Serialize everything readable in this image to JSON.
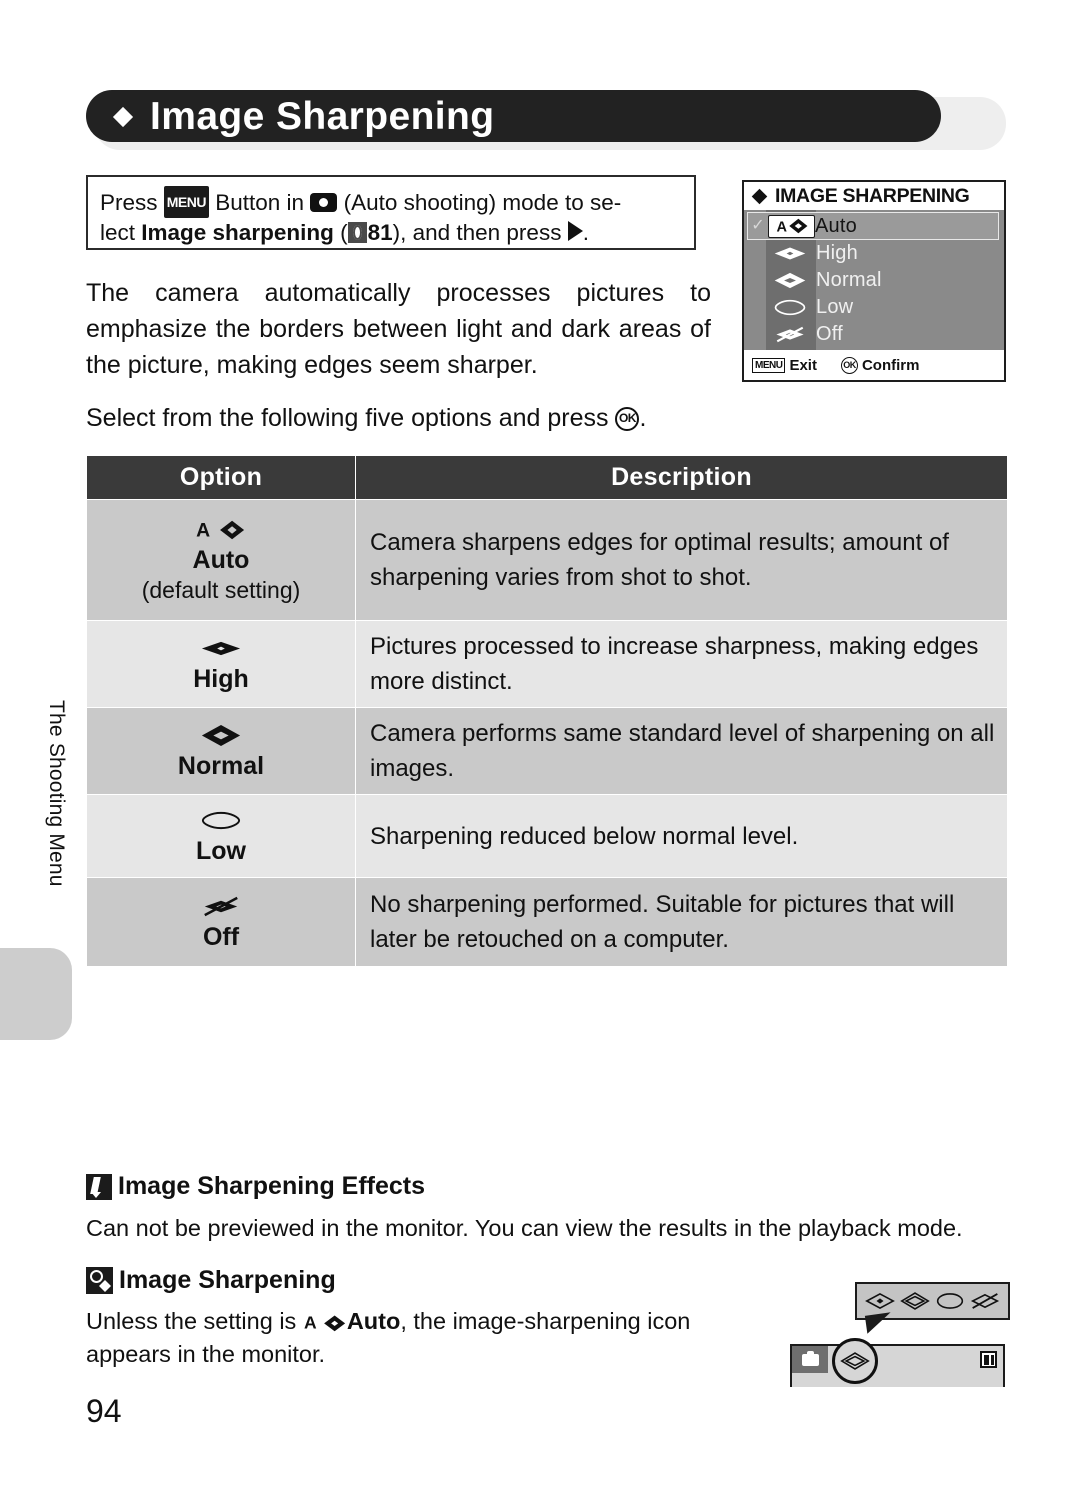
{
  "page": {
    "number": "94",
    "side_tab": "The Shooting Menu",
    "title": "Image Sharpening"
  },
  "instruction": {
    "line1_pre": "Press ",
    "menu_chip": "MENU",
    "line1_mid": " Button in ",
    "camera_icon": "camera-auto-icon",
    "line1_post": " (Auto shooting) mode to se-",
    "line2_pre": "lect ",
    "line2_bold": "Image sharpening",
    "line2_paren_open": " (",
    "ref_icon": "reference-book-icon",
    "ref_page": "81",
    "line2_post": "), and then press ",
    "line2_end": "."
  },
  "body": {
    "paragraph": "The camera automatically processes pictures to emphasize the borders between light and dark areas of the picture, making edges seem sharper.",
    "select_pre": "Select from the following five options and press ",
    "ok_label": "OK",
    "select_post": "."
  },
  "lcd": {
    "title": "IMAGE SHARPENING",
    "rows": [
      {
        "icon": "sharpening-auto-icon",
        "label": "Auto",
        "selected": true,
        "check": "✓"
      },
      {
        "icon": "sharpening-high-icon",
        "label": "High",
        "selected": false,
        "check": ""
      },
      {
        "icon": "sharpening-normal-icon",
        "label": "Normal",
        "selected": false,
        "check": ""
      },
      {
        "icon": "sharpening-low-icon",
        "label": "Low",
        "selected": false,
        "check": ""
      },
      {
        "icon": "sharpening-off-icon",
        "label": "Off",
        "selected": false,
        "check": ""
      }
    ],
    "footer": {
      "menu_chip": "MENU",
      "exit_label": "Exit",
      "ok_chip": "OK",
      "confirm_label": "Confirm"
    }
  },
  "table": {
    "headers": {
      "option": "Option",
      "description": "Description"
    },
    "rows": [
      {
        "icon": "sharpening-auto-icon",
        "name": "Auto",
        "sub": "(default setting)",
        "description": "Camera sharpens edges for optimal results; amount of sharpening varies from shot to shot."
      },
      {
        "icon": "sharpening-high-icon",
        "name": "High",
        "sub": "",
        "description": "Pictures processed to increase sharpness, making edges more distinct."
      },
      {
        "icon": "sharpening-normal-icon",
        "name": "Normal",
        "sub": "",
        "description": "Camera performs same standard level of sharpening on all images."
      },
      {
        "icon": "sharpening-low-icon",
        "name": "Low",
        "sub": "",
        "description": "Sharpening reduced below normal level."
      },
      {
        "icon": "sharpening-off-icon",
        "name": "Off",
        "sub": "",
        "description": "No sharpening performed. Suitable for pictures that will later be retouched on a computer."
      }
    ]
  },
  "notes": [
    {
      "icon": "pencil-note-icon",
      "heading": "Image Sharpening Effects",
      "body": "Can not be previewed in the monitor. You can view the results in the playback mode."
    },
    {
      "icon": "magnifier-note-icon",
      "heading": "Image Sharpening",
      "body_pre": "Unless the setting is ",
      "body_bold": "Auto",
      "body_post": ", the image-sharpening icon appears in the monitor."
    }
  ],
  "illustration": {
    "callout_icons": [
      "sharpening-high-icon",
      "sharpening-normal-icon",
      "sharpening-low-icon",
      "sharpening-off-icon"
    ],
    "monitor_mode_icon": "camera-auto-icon",
    "monitor_sharpening_icon": "sharpening-normal-icon",
    "monitor_battery_icon": "battery-icon"
  },
  "colors": {
    "header_bar": "#222222",
    "header_shadow": "#eeeeee",
    "table_header": "#3a3a3a",
    "row_shade_dark": "#c9c9c9",
    "row_shade_light": "#e6e6e6",
    "lcd_background": "#8a8a8a",
    "lcd_icon_column": "#6e6e6e",
    "lcd_selected": "#9a9a9a",
    "side_tab": "#cdcdcd"
  }
}
